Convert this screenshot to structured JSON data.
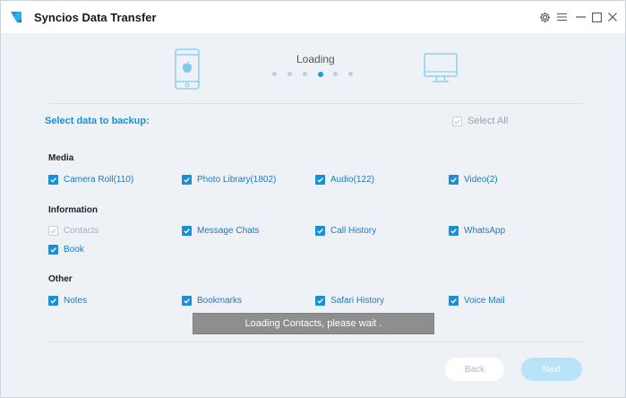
{
  "app": {
    "title": "Syncios Data Transfer"
  },
  "progress": {
    "label": "Loading",
    "step_count": 6,
    "active_step": 4
  },
  "selection": {
    "title": "Select data to backup:",
    "select_all_label": "Select All"
  },
  "sections": {
    "media": {
      "title": "Media",
      "items": [
        {
          "label": "Camera Roll(110)",
          "checked": true
        },
        {
          "label": "Photo Library(1802)",
          "checked": true
        },
        {
          "label": "Audio(122)",
          "checked": true
        },
        {
          "label": "Video(2)",
          "checked": true
        }
      ]
    },
    "information": {
      "title": "Information",
      "items": [
        {
          "label": "Contacts",
          "checked": true,
          "disabled": true
        },
        {
          "label": "Message Chats",
          "checked": true
        },
        {
          "label": "Call History",
          "checked": true
        },
        {
          "label": "WhatsApp",
          "checked": true
        },
        {
          "label": "Book",
          "checked": true
        }
      ]
    },
    "other": {
      "title": "Other",
      "items": [
        {
          "label": "Notes",
          "checked": true
        },
        {
          "label": "Bookmarks",
          "checked": true
        },
        {
          "label": "Safari History",
          "checked": true
        },
        {
          "label": "Voice Mail",
          "checked": true
        }
      ]
    }
  },
  "toast": {
    "message": "Loading Contacts, please wait ."
  },
  "buttons": {
    "back": "Back",
    "next": "Next"
  },
  "colors": {
    "accent": "#1a8fd6",
    "next_button": "#b9e4f8",
    "toast_bg": "#8e8e8e"
  }
}
